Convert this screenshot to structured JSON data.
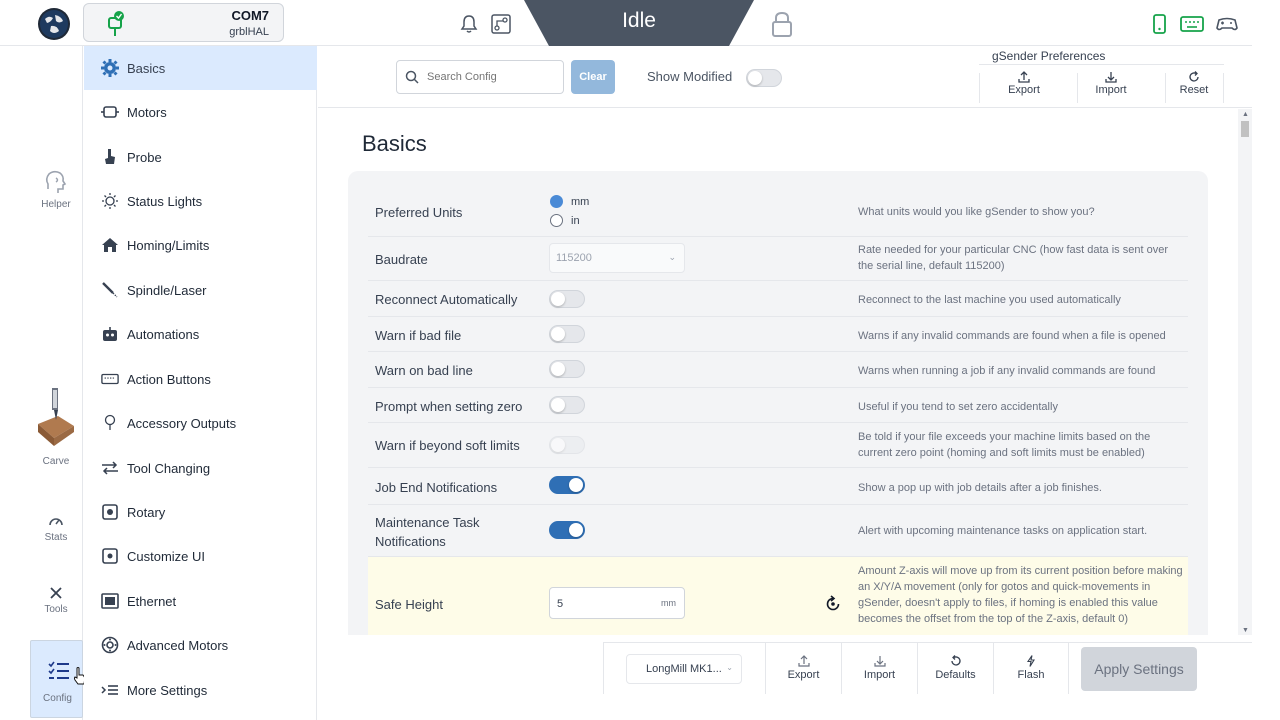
{
  "header": {
    "connection": {
      "port": "COM7",
      "firmware": "grblHAL"
    },
    "machine_state": "Idle"
  },
  "rail": {
    "items": [
      {
        "label": "Helper"
      },
      {
        "label": "Carve"
      },
      {
        "label": "Stats"
      },
      {
        "label": "Tools"
      },
      {
        "label": "Config"
      }
    ]
  },
  "nav": {
    "items": [
      {
        "label": "Basics",
        "icon": "gear-icon"
      },
      {
        "label": "Motors",
        "icon": "motor-icon"
      },
      {
        "label": "Probe",
        "icon": "probe-icon"
      },
      {
        "label": "Status Lights",
        "icon": "light-icon"
      },
      {
        "label": "Homing/Limits",
        "icon": "home-icon"
      },
      {
        "label": "Spindle/Laser",
        "icon": "spindle-icon"
      },
      {
        "label": "Automations",
        "icon": "robot-icon"
      },
      {
        "label": "Action Buttons",
        "icon": "keyboard-icon"
      },
      {
        "label": "Accessory Outputs",
        "icon": "bulb-icon"
      },
      {
        "label": "Tool Changing",
        "icon": "swap-icon"
      },
      {
        "label": "Rotary",
        "icon": "rotary-icon"
      },
      {
        "label": "Customize UI",
        "icon": "palette-icon"
      },
      {
        "label": "Ethernet",
        "icon": "ethernet-icon"
      },
      {
        "label": "Advanced Motors",
        "icon": "advanced-motor-icon"
      },
      {
        "label": "More Settings",
        "icon": "more-settings-icon"
      }
    ]
  },
  "toolbar": {
    "search_placeholder": "Search Config",
    "clear_label": "Clear",
    "show_modified_label": "Show Modified",
    "show_modified_on": false,
    "prefs_title": "gSender Preferences",
    "export_label": "Export",
    "import_label": "Import",
    "reset_label": "Reset"
  },
  "main": {
    "title": "Basics",
    "rows": [
      {
        "label": "Preferred Units",
        "options": [
          "mm",
          "in"
        ],
        "selected": "mm",
        "desc": "What units would you like gSender to show you?"
      },
      {
        "label": "Baudrate",
        "value": "115200",
        "desc": "Rate needed for your particular CNC (how fast data is sent over the serial line, default 115200)"
      },
      {
        "label": "Reconnect Automatically",
        "on": false,
        "desc": "Reconnect to the last machine you used automatically"
      },
      {
        "label": "Warn if bad file",
        "on": false,
        "desc": "Warns if any invalid commands are found when a file is opened"
      },
      {
        "label": "Warn on bad line",
        "on": false,
        "desc": "Warns when running a job if any invalid commands are found"
      },
      {
        "label": "Prompt when setting zero",
        "on": false,
        "desc": "Useful if you tend to set zero accidentally"
      },
      {
        "label": "Warn if beyond soft limits",
        "on": false,
        "desc": "Be told if your file exceeds your machine limits based on the current zero point (homing and soft limits must be enabled)"
      },
      {
        "label": "Job End Notifications",
        "on": true,
        "desc": "Show a pop up with job details after a job finishes."
      },
      {
        "label": "Maintenance Task Notifications",
        "on": true,
        "desc": "Alert with upcoming maintenance tasks on application start."
      },
      {
        "label": "Safe Height",
        "value": "5",
        "unit": "mm",
        "desc": "Amount Z-axis will move up from its current position before making an X/Y/A movement (only for gotos and quick-movements in gSender, doesn't apply to files, if homing is enabled this value becomes the offset from the top of the Z-axis, default 0)"
      }
    ]
  },
  "footer": {
    "machine_profile": "LongMill MK1...",
    "export_label": "Export",
    "import_label": "Import",
    "defaults_label": "Defaults",
    "flash_label": "Flash",
    "apply_label": "Apply Settings"
  },
  "colors": {
    "accent": "#2f6fb5",
    "active_bg": "#dbeafe",
    "state_bg": "#4b5563",
    "connected": "#16a34a",
    "highlight_row": "#fefce8"
  }
}
